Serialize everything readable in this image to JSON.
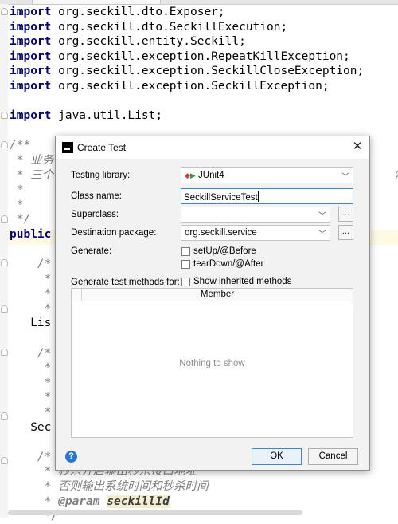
{
  "editor": {
    "lines": [
      [
        {
          "t": "import",
          "c": "kw"
        },
        {
          "t": " org.seckill.dto.Exposer;"
        }
      ],
      [
        {
          "t": "import",
          "c": "kw"
        },
        {
          "t": " org.seckill.dto.SeckillExecution;"
        }
      ],
      [
        {
          "t": "import",
          "c": "kw"
        },
        {
          "t": " org.seckill.entity.Seckill;"
        }
      ],
      [
        {
          "t": "import",
          "c": "kw"
        },
        {
          "t": " org.seckill.exception.RepeatKillException;"
        }
      ],
      [
        {
          "t": "import",
          "c": "kw"
        },
        {
          "t": " org.seckill.exception.SeckillCloseException;"
        }
      ],
      [
        {
          "t": "import",
          "c": "kw"
        },
        {
          "t": " org.seckill.exception.SeckillException;"
        }
      ],
      [],
      [
        {
          "t": "import",
          "c": "kw"
        },
        {
          "t": " java.util.List;"
        }
      ],
      [],
      [
        {
          "t": "/**",
          "c": "cm"
        }
      ],
      [
        {
          "t": " * 业务",
          "c": "cm"
        }
      ],
      [
        {
          "t": " * 三个",
          "c": "cm"
        },
        {
          "t": "                                                 常）",
          "c": "cm"
        }
      ],
      [
        {
          "t": " *",
          "c": "cm"
        }
      ],
      [
        {
          "t": " *",
          "c": "cm"
        }
      ],
      [
        {
          "t": " */",
          "c": "cm"
        }
      ],
      [
        {
          "t": "public",
          "c": "kw"
        }
      ],
      [],
      [
        {
          "t": "    /*",
          "c": "cm"
        }
      ],
      [
        {
          "t": "     *",
          "c": "cm"
        }
      ],
      [
        {
          "t": "     *",
          "c": "cm"
        }
      ],
      [
        {
          "t": "     *",
          "c": "cm"
        }
      ],
      [
        {
          "t": "   Lis"
        }
      ],
      [],
      [
        {
          "t": "    /*",
          "c": "cm"
        }
      ],
      [
        {
          "t": "     *",
          "c": "cm"
        }
      ],
      [
        {
          "t": "     *",
          "c": "cm"
        }
      ],
      [
        {
          "t": "     *",
          "c": "cm"
        }
      ],
      [
        {
          "t": "     *",
          "c": "cm"
        }
      ],
      [
        {
          "t": "   Sec"
        }
      ],
      [],
      [
        {
          "t": "    /*",
          "c": "cm"
        }
      ],
      [
        {
          "t": "     * 秒杀开启输出秒杀接口地址",
          "c": "cm"
        }
      ],
      [
        {
          "t": "     * 否则输出系统时间和秒杀时间",
          "c": "cm"
        }
      ],
      [
        {
          "t": "     * ",
          "c": "cm"
        },
        {
          "t": "@param",
          "c": "tag"
        },
        {
          "t": " "
        },
        {
          "t": "seckillId",
          "c": "param"
        }
      ],
      [
        {
          "t": "     */",
          "c": "cm"
        }
      ]
    ]
  },
  "dialog": {
    "title": "Create Test",
    "close_glyph": "✕",
    "testing_library_label": "Testing library:",
    "testing_library_value": "JUnit4",
    "class_name_label": "Class name:",
    "class_name_value": "SeckillServiceTest",
    "superclass_label": "Superclass:",
    "superclass_value": "",
    "destination_label": "Destination package:",
    "destination_value": "org.seckill.service",
    "generate_label": "Generate:",
    "setup_label": "setUp/@Before",
    "teardown_label": "tearDown/@After",
    "methods_label": "Generate test methods for:",
    "show_inherited_label": "Show inherited methods",
    "member_header": "Member",
    "empty_text": "Nothing to show",
    "ok_label": "OK",
    "cancel_label": "Cancel",
    "help_glyph": "?",
    "dots_label": "..."
  }
}
